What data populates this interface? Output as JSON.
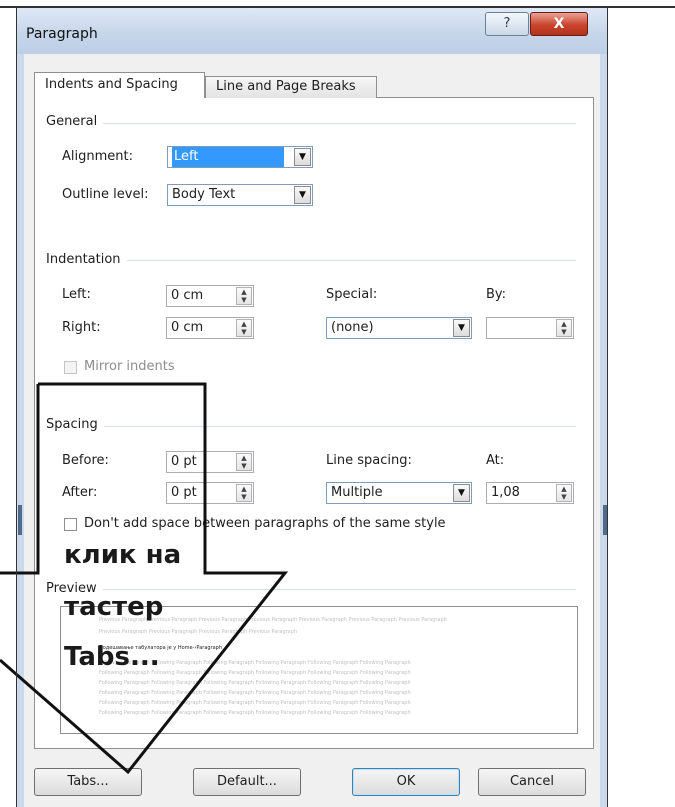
{
  "dialog": {
    "title": "Paragraph",
    "help_label": "?",
    "close_label": "X"
  },
  "tabs": [
    {
      "label": "Indents and Spacing",
      "active": true
    },
    {
      "label": "Line and Page Breaks",
      "active": false
    }
  ],
  "general": {
    "heading": "General",
    "alignment_label": "Alignment:",
    "alignment_value": "Left",
    "outline_label": "Outline level:",
    "outline_value": "Body Text"
  },
  "indentation": {
    "heading": "Indentation",
    "left_label": "Left:",
    "left_value": "0 cm",
    "right_label": "Right:",
    "right_value": "0 cm",
    "special_label": "Special:",
    "special_value": "(none)",
    "by_label": "By:",
    "by_value": "",
    "mirror_label": "Mirror indents"
  },
  "spacing": {
    "heading": "Spacing",
    "before_label": "Before:",
    "before_value": "0 pt",
    "after_label": "After:",
    "after_value": "0 pt",
    "line_spacing_label": "Line spacing:",
    "line_spacing_value": "Multiple",
    "at_label": "At:",
    "at_value": "1,08",
    "dont_add_label": "Don't add space between paragraphs of the same style"
  },
  "preview": {
    "heading": "Preview",
    "lines": [
      "Previous Paragraph Previous Paragraph Previous Paragraph Previous Paragraph Previous Paragraph Previous Paragraph Previous Paragraph",
      "Previous Paragraph Previous Paragraph Previous Paragraph Previous Paragraph",
      "Подешавање табулатора је у Home-›Paragraph",
      "Following Paragraph Following Paragraph Following Paragraph Following Paragraph Following Paragraph Following Paragraph",
      "Following Paragraph Following Paragraph Following Paragraph Following Paragraph Following Paragraph Following Paragraph",
      "Following Paragraph Following Paragraph Following Paragraph Following Paragraph Following Paragraph Following Paragraph",
      "Following Paragraph Following Paragraph Following Paragraph Following Paragraph Following Paragraph Following Paragraph",
      "Following Paragraph Following Paragraph Following Paragraph Following Paragraph Following Paragraph Following Paragraph",
      "Following Paragraph Following Paragraph Following Paragraph Following Paragraph Following Paragraph Following Paragraph"
    ]
  },
  "buttons": {
    "tabs": "Tabs...",
    "default": "Default...",
    "ok": "OK",
    "cancel": "Cancel"
  },
  "annotation": {
    "line1": "клик на",
    "line2": "тастер",
    "line3": "Tabs..."
  }
}
